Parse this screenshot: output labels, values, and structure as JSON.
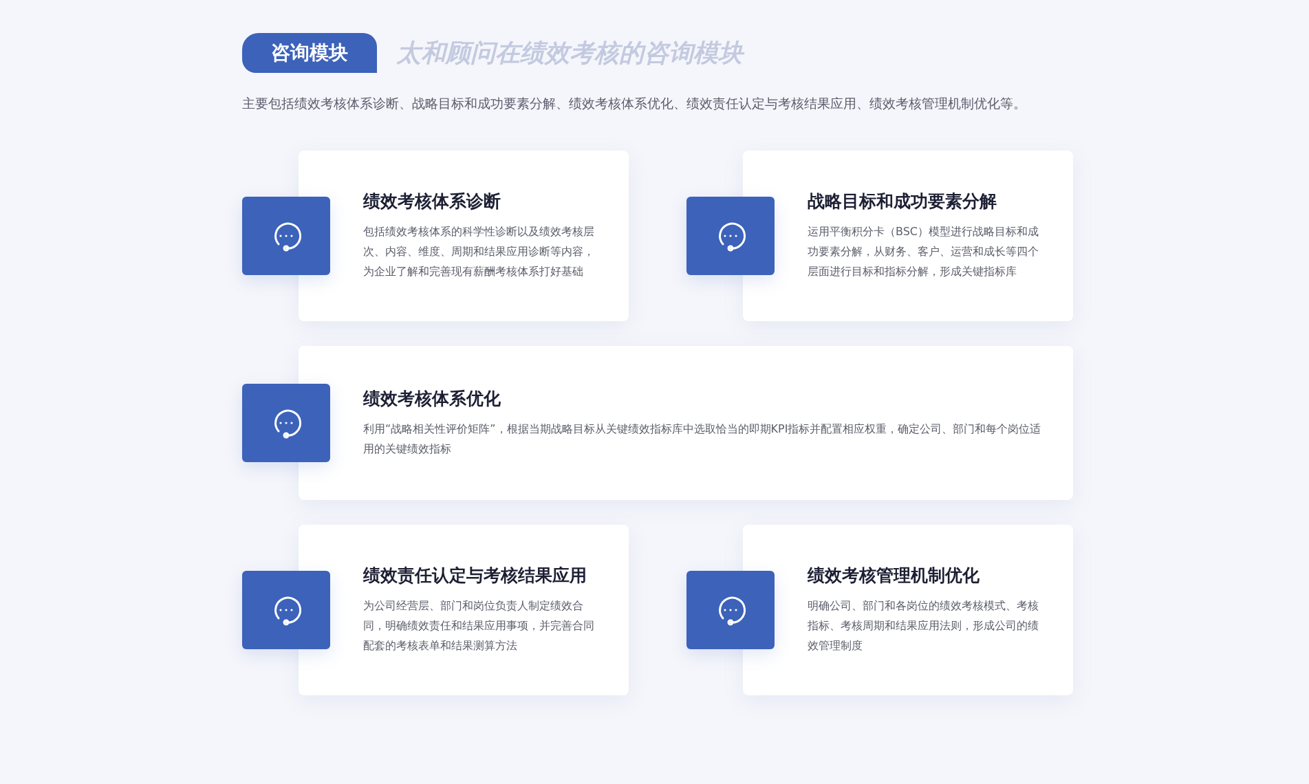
{
  "header": {
    "tag": "咨询模块",
    "subtitle": "太和顾问在绩效考核的咨询模块",
    "description": "主要包括绩效考核体系诊断、战略目标和成功要素分解、绩效考核体系优化、绩效责任认定与考核结果应用、绩效考核管理机制优化等。"
  },
  "rows": [
    [
      {
        "title": "绩效考核体系诊断",
        "body": "包括绩效考核体系的科学性诊断以及绩效考核层次、内容、维度、周期和结果应用诊断等内容，为企业了解和完善现有薪酬考核体系打好基础"
      },
      {
        "title": "战略目标和成功要素分解",
        "body": "运用平衡积分卡（BSC）模型进行战略目标和成功要素分解，从财务、客户、运营和成长等四个层面进行目标和指标分解，形成关键指标库"
      }
    ],
    [
      {
        "title": "绩效考核体系优化",
        "body": "利用“战略相关性评价矩阵”，根据当期战略目标从关键绩效指标库中选取恰当的即期KPI指标并配置相应权重，确定公司、部门和每个岗位适用的关键绩效指标"
      }
    ],
    [
      {
        "title": "绩效责任认定与考核结果应用",
        "body": "为公司经营层、部门和岗位负责人制定绩效合同，明确绩效责任和结果应用事项，并完善合同配套的考核表单和结果测算方法"
      },
      {
        "title": "绩效考核管理机制优化",
        "body": "明确公司、部门和各岗位的绩效考核模式、考核指标、考核周期和结果应用法则，形成公司的绩效管理制度"
      }
    ]
  ]
}
